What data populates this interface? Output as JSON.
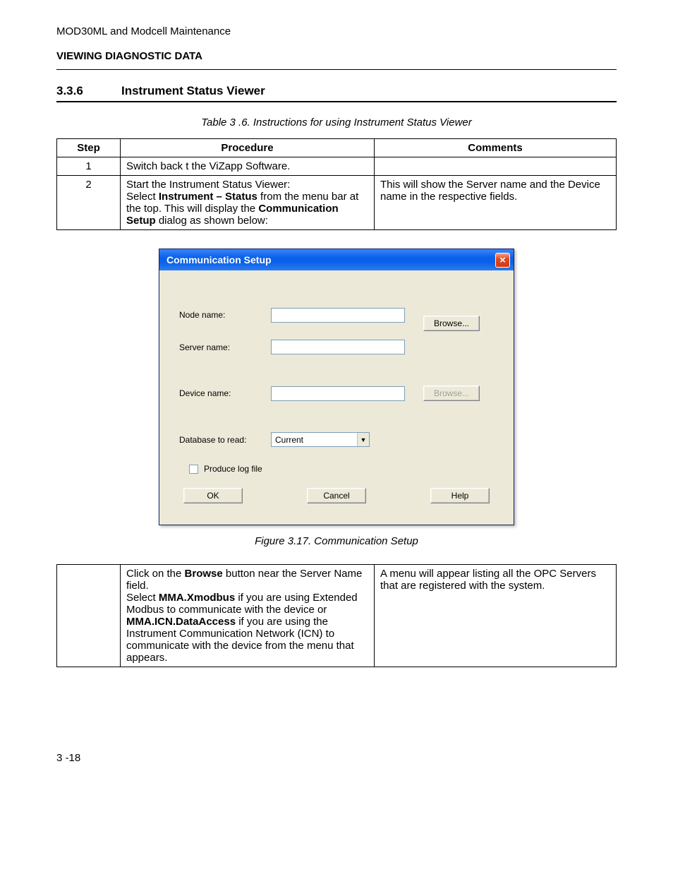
{
  "header": {
    "doc_title": "MOD30ML and Modcell Maintenance",
    "section_breadcrumb": "VIEWING DIAGNOSTIC DATA"
  },
  "section": {
    "number": "3.3.6",
    "title": "Instrument Status Viewer"
  },
  "table_caption": "Table 3 .6. Instructions for using Instrument Status Viewer",
  "table1": {
    "headers": {
      "step": "Step",
      "procedure": "Procedure",
      "comments": "Comments"
    },
    "rows": [
      {
        "step": "1",
        "procedure_plain": "Switch back t the ViZapp Software.",
        "comments": ""
      },
      {
        "step": "2",
        "procedure_parts": {
          "p1": "Start the Instrument Status Viewer:",
          "p2a": "Select ",
          "p2b": "Instrument – Status",
          "p2c": " from the menu bar at the top. This will display the ",
          "p2d": "Communication Setup",
          "p2e": " dialog as shown below:"
        },
        "comments": "This will show the Server name and the Device name in the respective fields."
      }
    ]
  },
  "dialog": {
    "title": "Communication Setup",
    "labels": {
      "node": "Node name:",
      "server": "Server name:",
      "device": "Device name:",
      "db": "Database to read:",
      "logfile": "Produce log file"
    },
    "values": {
      "node": "",
      "server": "",
      "device": "",
      "db_selected": "Current",
      "logfile_checked": false
    },
    "buttons": {
      "browse": "Browse...",
      "ok": "OK",
      "cancel": "Cancel",
      "help": "Help"
    }
  },
  "figure_caption": "Figure 3.17. Communication Setup",
  "table2": {
    "row": {
      "procedure_parts": {
        "a": "Click on the ",
        "b": "Browse",
        "c": " button near the Server Name field.",
        "d": "Select ",
        "e": "MMA.Xmodbus",
        "f": " if you are using Extended Modbus to communicate with the device or ",
        "g": "MMA.ICN.DataAccess",
        "h": " if you are using the Instrument Communication Network (ICN) to communicate with the device from the menu that appears."
      },
      "comments": "A menu will appear listing all the OPC Servers that are registered with the system."
    }
  },
  "footer": {
    "page": "3 -18"
  }
}
